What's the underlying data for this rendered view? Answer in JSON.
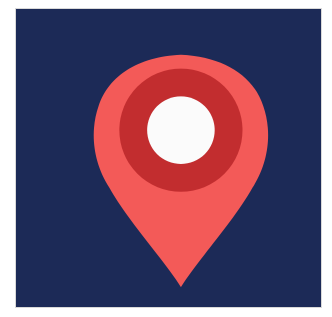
{
  "icon": {
    "name": "map-pin-icon",
    "background_color": "#1c2a57",
    "pin_color": "#f35a58",
    "ring_color": "#c22d2f",
    "dot_color": "#fbfbfb",
    "border_color": "#d9d9d9"
  }
}
